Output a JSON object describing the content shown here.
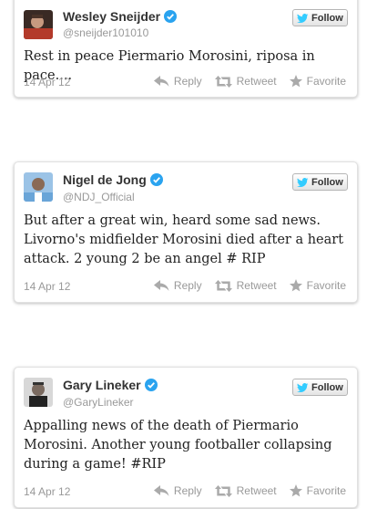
{
  "tweets": [
    {
      "name": "Wesley Sneijder",
      "handle": "@sneijder101010",
      "text": "Rest in peace Piermario Morosini, riposa in pace....",
      "date": "14 Apr 12"
    },
    {
      "name": "Nigel de Jong",
      "handle": "@NDJ_Official",
      "text": "But after a great win, heard some sad news. Livorno's midfielder Morosini died after a heart attack. 2 young 2 be an angel # RIP",
      "date": "14 Apr 12"
    },
    {
      "name": "Gary Lineker",
      "handle": "@GaryLineker",
      "text": "Appalling news of the death of Piermario Morosini. Another young footballer collapsing during a game! #RIP",
      "date": "14 Apr 12"
    }
  ],
  "labels": {
    "follow": "Follow",
    "reply": "Reply",
    "retweet": "Retweet",
    "favorite": "Favorite"
  },
  "colors": {
    "verified_badge": "#2aa3ef",
    "twitter_bird": "#33ccff",
    "action_icon": "#aaaaaa"
  },
  "icons": [
    "verified-icon",
    "twitter-bird-icon",
    "reply-icon",
    "retweet-icon",
    "favorite-star-icon"
  ]
}
